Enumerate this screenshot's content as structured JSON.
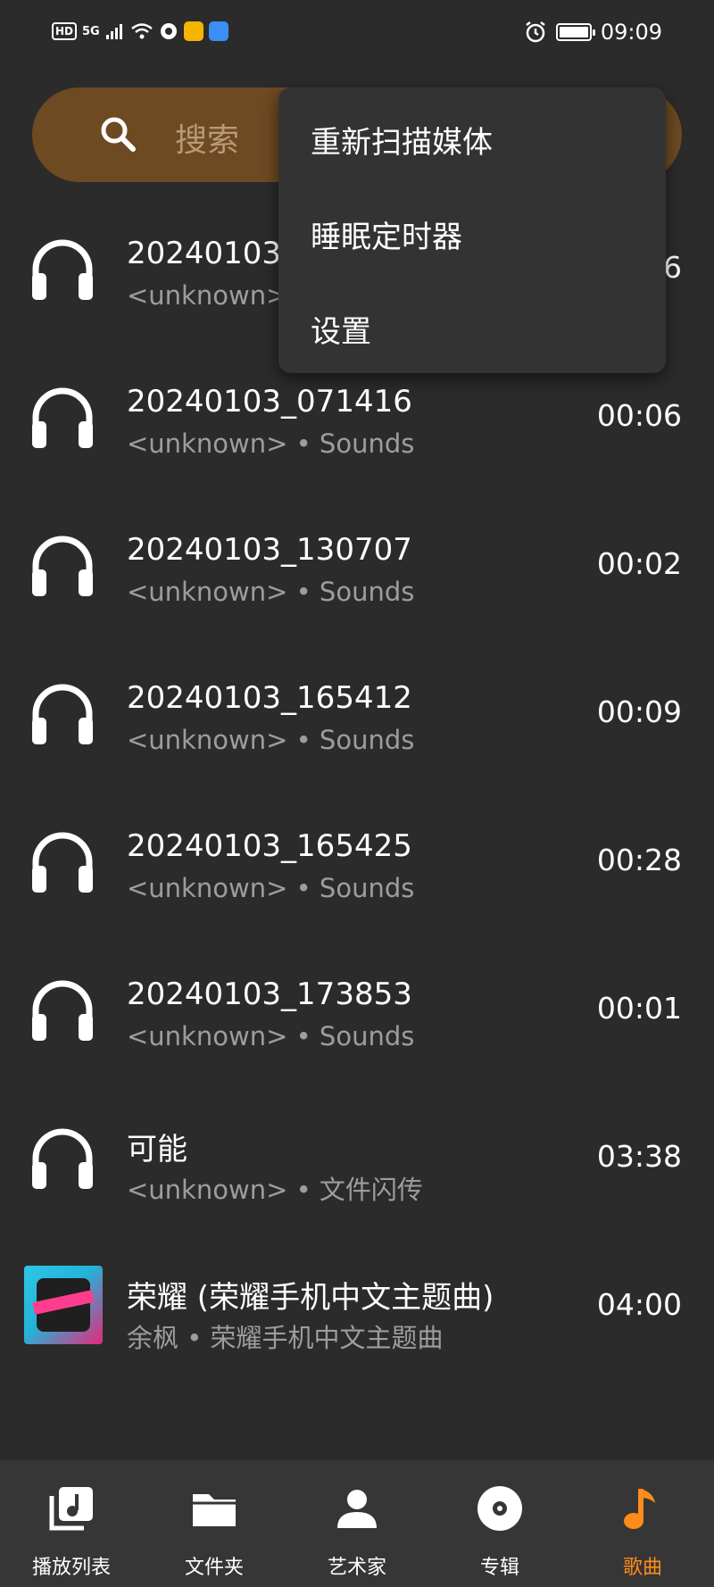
{
  "status_bar": {
    "left_indicators": [
      "HD",
      "5G"
    ],
    "time": "09:09"
  },
  "search": {
    "placeholder": "搜索"
  },
  "menu": {
    "items": [
      "重新扫描媒体",
      "睡眠定时器",
      "设置"
    ]
  },
  "songs": [
    {
      "title": "20240103_",
      "subtitle": "<unknown> •",
      "duration": "6",
      "icon": "headphones-icon"
    },
    {
      "title": "20240103_071416",
      "subtitle": "<unknown> • Sounds",
      "duration": "00:06",
      "icon": "headphones-icon"
    },
    {
      "title": "20240103_130707",
      "subtitle": "<unknown> • Sounds",
      "duration": "00:02",
      "icon": "headphones-icon"
    },
    {
      "title": "20240103_165412",
      "subtitle": "<unknown> • Sounds",
      "duration": "00:09",
      "icon": "headphones-icon"
    },
    {
      "title": "20240103_165425",
      "subtitle": "<unknown> • Sounds",
      "duration": "00:28",
      "icon": "headphones-icon"
    },
    {
      "title": "20240103_173853",
      "subtitle": "<unknown> • Sounds",
      "duration": "00:01",
      "icon": "headphones-icon"
    },
    {
      "title": "可能",
      "subtitle": "<unknown> • 文件闪传",
      "duration": "03:38",
      "icon": "headphones-icon"
    },
    {
      "title": "荣耀 (荣耀手机中文主题曲)",
      "subtitle": "余枫 • 荣耀手机中文主题曲",
      "duration": "04:00",
      "icon": "album-art"
    }
  ],
  "bottom_nav": {
    "items": [
      {
        "label": "播放列表",
        "icon": "playlist-icon",
        "active": false
      },
      {
        "label": "文件夹",
        "icon": "folder-icon",
        "active": false
      },
      {
        "label": "艺术家",
        "icon": "artist-icon",
        "active": false
      },
      {
        "label": "专辑",
        "icon": "album-icon",
        "active": false
      },
      {
        "label": "歌曲",
        "icon": "music-note-icon",
        "active": true
      }
    ]
  },
  "colors": {
    "background": "#2b2b2b",
    "search_bar": "#6d4a22",
    "accent": "#ff8c1a",
    "menu_bg": "#333333",
    "nav_bg": "#363636"
  }
}
